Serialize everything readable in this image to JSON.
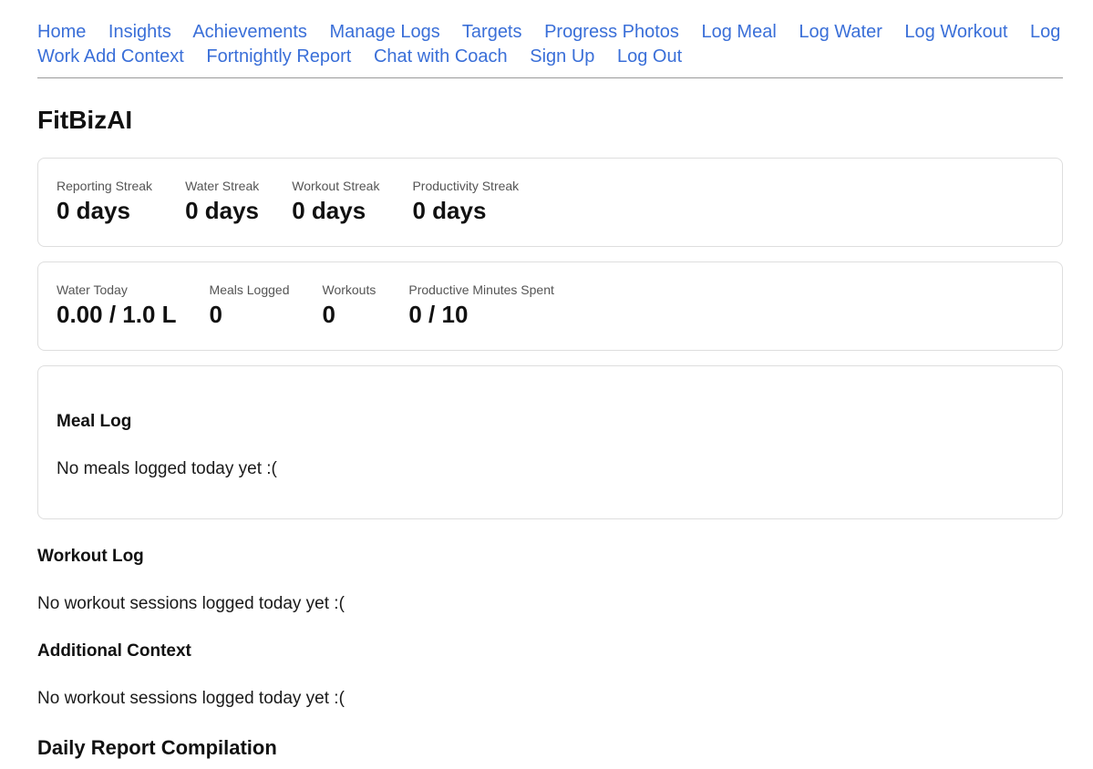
{
  "nav": {
    "links": [
      {
        "label": "Home"
      },
      {
        "label": "Insights"
      },
      {
        "label": "Achievements"
      },
      {
        "label": "Manage Logs"
      },
      {
        "label": "Targets"
      },
      {
        "label": "Progress Photos"
      },
      {
        "label": "Log Meal"
      },
      {
        "label": "Log Water"
      },
      {
        "label": "Log Workout"
      },
      {
        "label": "Log Work"
      },
      {
        "label": "Add Context"
      },
      {
        "label": "Fortnightly Report"
      },
      {
        "label": "Chat with Coach"
      },
      {
        "label": "Sign Up"
      },
      {
        "label": "Log Out"
      }
    ],
    "link_color": "#3a6fd8"
  },
  "app": {
    "title": "FitBizAI"
  },
  "streaks": [
    {
      "label": "Reporting Streak",
      "value": "0 days"
    },
    {
      "label": "Water Streak",
      "value": "0 days"
    },
    {
      "label": "Workout Streak",
      "value": "0 days"
    },
    {
      "label": "Productivity Streak",
      "value": "0 days"
    }
  ],
  "today": [
    {
      "label": "Water Today",
      "value": "0.00 / 1.0 L"
    },
    {
      "label": "Meals Logged",
      "value": "0"
    },
    {
      "label": "Workouts",
      "value": "0"
    },
    {
      "label": "Productive Minutes Spent",
      "value": "0 / 10"
    }
  ],
  "meal_log": {
    "heading": "Meal Log",
    "empty_text": "No meals logged today yet :("
  },
  "workout_log": {
    "heading": "Workout Log",
    "empty_text": "No workout sessions logged today yet :("
  },
  "additional_context": {
    "heading": "Additional Context",
    "empty_text": "No workout sessions logged today yet :("
  },
  "daily_report": {
    "heading": "Daily Report Compilation"
  }
}
